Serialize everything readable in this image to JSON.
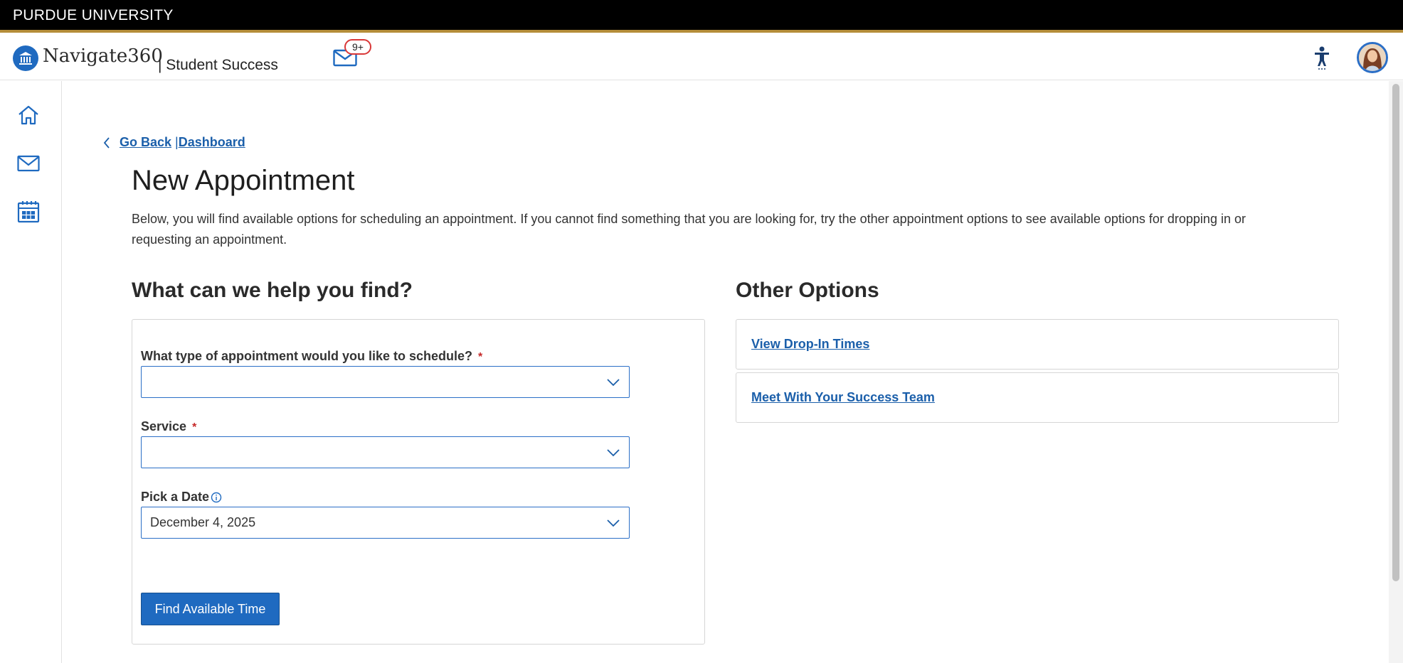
{
  "university": {
    "name": "PURDUE UNIVERSITY"
  },
  "header": {
    "brand": "Navigate360",
    "brand_sub": "| Student Success",
    "mail_badge": "9+"
  },
  "sidebar": {
    "items": [
      {
        "name": "home",
        "icon": "home-icon"
      },
      {
        "name": "messages",
        "icon": "mail-icon"
      },
      {
        "name": "calendar",
        "icon": "calendar-icon"
      }
    ]
  },
  "breadcrumb": {
    "back_label": "Go Back",
    "separator": "|",
    "dashboard_label": "Dashboard"
  },
  "page": {
    "title": "New Appointment",
    "intro": "Below, you will find available options for scheduling an appointment. If you cannot find something that you are looking for, try the other appointment options to see available options for dropping in or requesting an appointment."
  },
  "form": {
    "section_title": "What can we help you find?",
    "appointment_type": {
      "label": "What type of appointment would you like to schedule?",
      "required_mark": "*",
      "value": ""
    },
    "service": {
      "label": "Service",
      "required_mark": "*",
      "value": ""
    },
    "date": {
      "label": "Pick a Date",
      "value": "December 4, 2025"
    },
    "submit_label": "Find Available Time"
  },
  "other_options": {
    "section_title": "Other Options",
    "items": [
      {
        "label": "View Drop-In Times"
      },
      {
        "label": "Meet With Your Success Team"
      }
    ]
  },
  "colors": {
    "primary": "#1f6ac0",
    "link": "#1b5faa",
    "gold_rule": "#b58e3a",
    "required": "#c62828",
    "badge_border": "#d93838"
  }
}
